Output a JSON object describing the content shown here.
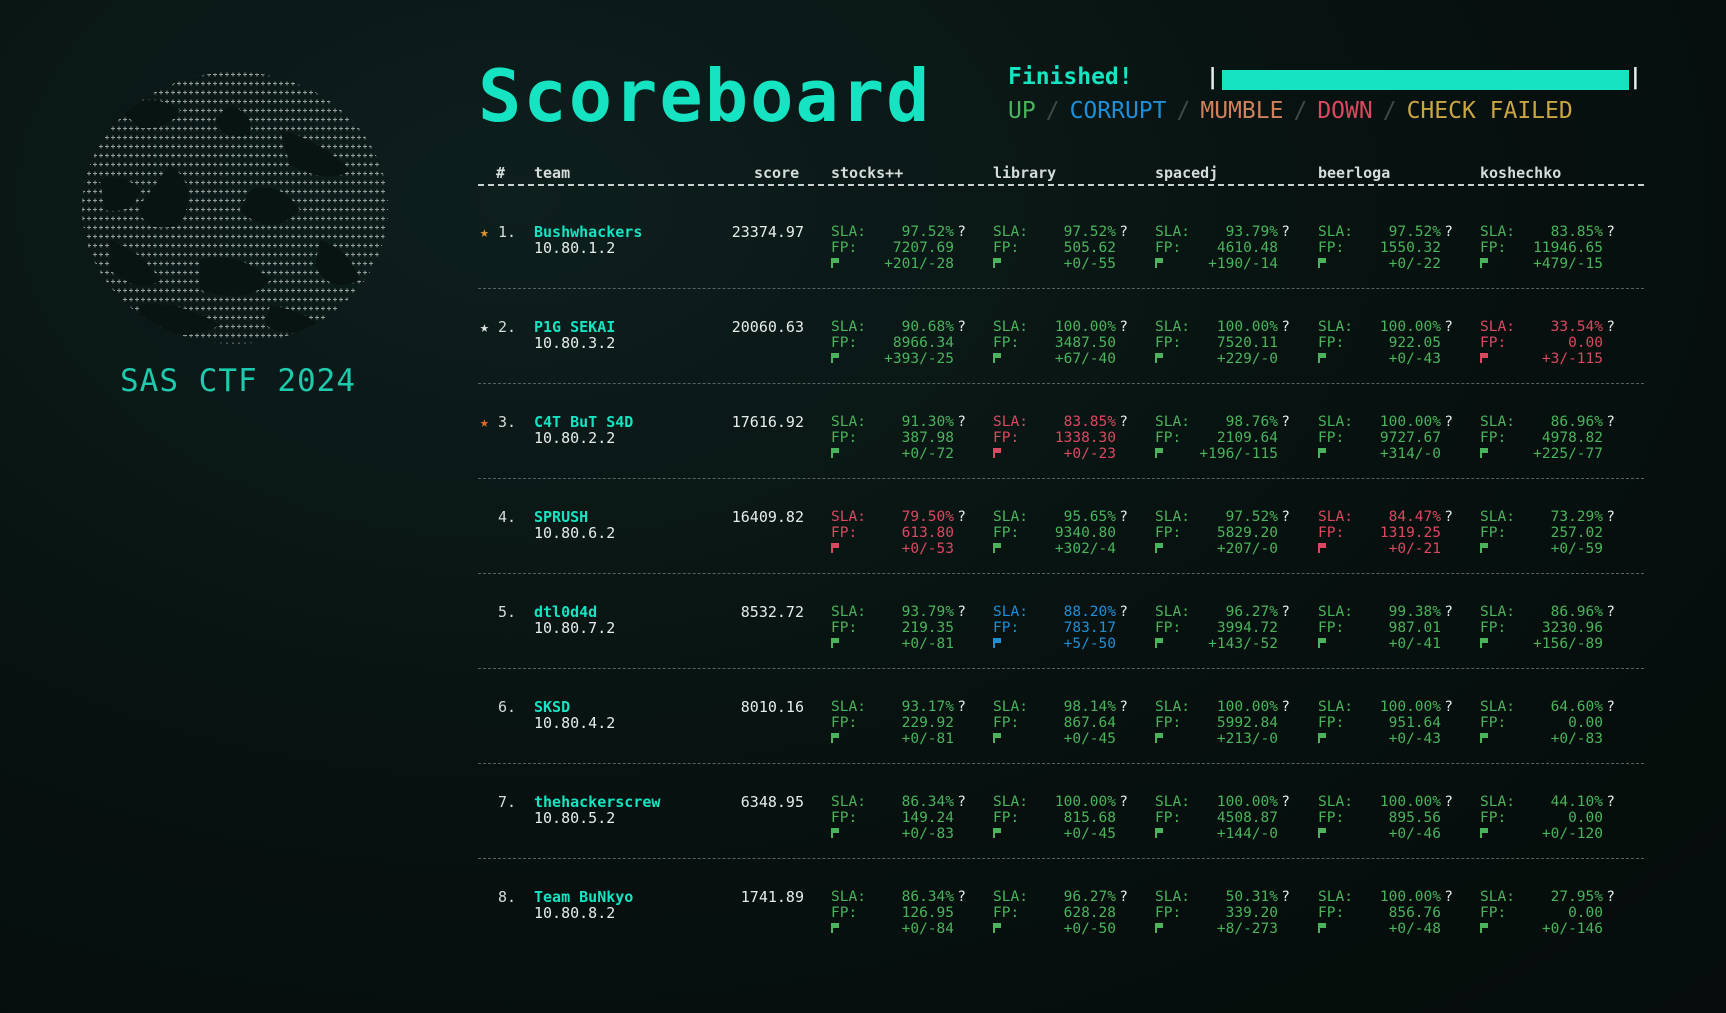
{
  "logo": {
    "icon": "ascii-globe-logo"
  },
  "event_title": "SAS CTF 2024",
  "page_title": "Scoreboard",
  "status": {
    "text": "Finished!",
    "progress": 1.0
  },
  "legend": [
    "UP",
    "CORRUPT",
    "MUMBLE",
    "DOWN",
    "CHECK FAILED"
  ],
  "colors": {
    "accent": "#15e3c1",
    "up": "#4ab35b",
    "corrupt": "#1e8fd6",
    "mumble": "#d0805b",
    "down": "#d9495f",
    "check_failed": "#c9a544"
  },
  "headers": {
    "rank": "#",
    "team": "team",
    "score": "score",
    "services": [
      "stocks++",
      "library",
      "spacedj",
      "beerloga",
      "koshechko"
    ]
  },
  "labels": {
    "sla": "SLA:",
    "fp": "FP:",
    "q": "?"
  },
  "teams": [
    {
      "rank": "1.",
      "star": "gold",
      "name": "Bushwhackers",
      "ip": "10.80.1.2",
      "score": "23374.97",
      "services": [
        {
          "state": "up",
          "sla": "97.52%",
          "fp": "7207.69",
          "flags": "+201/-28"
        },
        {
          "state": "up",
          "sla": "97.52%",
          "fp": "505.62",
          "flags": "+0/-55"
        },
        {
          "state": "up",
          "sla": "93.79%",
          "fp": "4610.48",
          "flags": "+190/-14"
        },
        {
          "state": "up",
          "sla": "97.52%",
          "fp": "1550.32",
          "flags": "+0/-22"
        },
        {
          "state": "up",
          "sla": "83.85%",
          "fp": "11946.65",
          "flags": "+479/-15"
        }
      ]
    },
    {
      "rank": "2.",
      "star": "silver",
      "name": "P1G SEKAI",
      "ip": "10.80.3.2",
      "score": "20060.63",
      "services": [
        {
          "state": "up",
          "sla": "90.68%",
          "fp": "8966.34",
          "flags": "+393/-25"
        },
        {
          "state": "up",
          "sla": "100.00%",
          "fp": "3487.50",
          "flags": "+67/-40"
        },
        {
          "state": "up",
          "sla": "100.00%",
          "fp": "7520.11",
          "flags": "+229/-0"
        },
        {
          "state": "up",
          "sla": "100.00%",
          "fp": "922.05",
          "flags": "+0/-43"
        },
        {
          "state": "down",
          "sla": "33.54%",
          "fp": "0.00",
          "flags": "+3/-115"
        }
      ]
    },
    {
      "rank": "3.",
      "star": "bronze",
      "name": "C4T BuT S4D",
      "ip": "10.80.2.2",
      "score": "17616.92",
      "services": [
        {
          "state": "up",
          "sla": "91.30%",
          "fp": "387.98",
          "flags": "+0/-72"
        },
        {
          "state": "down",
          "sla": "83.85%",
          "fp": "1338.30",
          "flags": "+0/-23"
        },
        {
          "state": "up",
          "sla": "98.76%",
          "fp": "2109.64",
          "flags": "+196/-115"
        },
        {
          "state": "up",
          "sla": "100.00%",
          "fp": "9727.67",
          "flags": "+314/-0"
        },
        {
          "state": "up",
          "sla": "86.96%",
          "fp": "4978.82",
          "flags": "+225/-77"
        }
      ]
    },
    {
      "rank": "4.",
      "star": "",
      "name": "SPRUSH",
      "ip": "10.80.6.2",
      "score": "16409.82",
      "services": [
        {
          "state": "down",
          "sla": "79.50%",
          "fp": "613.80",
          "flags": "+0/-53"
        },
        {
          "state": "up",
          "sla": "95.65%",
          "fp": "9340.80",
          "flags": "+302/-4"
        },
        {
          "state": "up",
          "sla": "97.52%",
          "fp": "5829.20",
          "flags": "+207/-0"
        },
        {
          "state": "down",
          "sla": "84.47%",
          "fp": "1319.25",
          "flags": "+0/-21"
        },
        {
          "state": "up",
          "sla": "73.29%",
          "fp": "257.02",
          "flags": "+0/-59"
        }
      ]
    },
    {
      "rank": "5.",
      "star": "",
      "name": "dtl0d4d",
      "ip": "10.80.7.2",
      "score": "8532.72",
      "services": [
        {
          "state": "up",
          "sla": "93.79%",
          "fp": "219.35",
          "flags": "+0/-81"
        },
        {
          "state": "corrupt",
          "sla": "88.20%",
          "fp": "783.17",
          "flags": "+5/-50"
        },
        {
          "state": "up",
          "sla": "96.27%",
          "fp": "3994.72",
          "flags": "+143/-52"
        },
        {
          "state": "up",
          "sla": "99.38%",
          "fp": "987.01",
          "flags": "+0/-41"
        },
        {
          "state": "up",
          "sla": "86.96%",
          "fp": "3230.96",
          "flags": "+156/-89"
        }
      ]
    },
    {
      "rank": "6.",
      "star": "",
      "name": "SKSD",
      "ip": "10.80.4.2",
      "score": "8010.16",
      "services": [
        {
          "state": "up",
          "sla": "93.17%",
          "fp": "229.92",
          "flags": "+0/-81"
        },
        {
          "state": "up",
          "sla": "98.14%",
          "fp": "867.64",
          "flags": "+0/-45"
        },
        {
          "state": "up",
          "sla": "100.00%",
          "fp": "5992.84",
          "flags": "+213/-0"
        },
        {
          "state": "up",
          "sla": "100.00%",
          "fp": "951.64",
          "flags": "+0/-43"
        },
        {
          "state": "up",
          "sla": "64.60%",
          "fp": "0.00",
          "flags": "+0/-83"
        }
      ]
    },
    {
      "rank": "7.",
      "star": "",
      "name": "thehackerscrew",
      "ip": "10.80.5.2",
      "score": "6348.95",
      "services": [
        {
          "state": "up",
          "sla": "86.34%",
          "fp": "149.24",
          "flags": "+0/-83"
        },
        {
          "state": "up",
          "sla": "100.00%",
          "fp": "815.68",
          "flags": "+0/-45"
        },
        {
          "state": "up",
          "sla": "100.00%",
          "fp": "4508.87",
          "flags": "+144/-0"
        },
        {
          "state": "up",
          "sla": "100.00%",
          "fp": "895.56",
          "flags": "+0/-46"
        },
        {
          "state": "up",
          "sla": "44.10%",
          "fp": "0.00",
          "flags": "+0/-120"
        }
      ]
    },
    {
      "rank": "8.",
      "star": "",
      "name": "Team BuNkyo",
      "ip": "10.80.8.2",
      "score": "1741.89",
      "services": [
        {
          "state": "up",
          "sla": "86.34%",
          "fp": "126.95",
          "flags": "+0/-84"
        },
        {
          "state": "up",
          "sla": "96.27%",
          "fp": "628.28",
          "flags": "+0/-50"
        },
        {
          "state": "up",
          "sla": "50.31%",
          "fp": "339.20",
          "flags": "+8/-273"
        },
        {
          "state": "up",
          "sla": "100.00%",
          "fp": "856.76",
          "flags": "+0/-48"
        },
        {
          "state": "up",
          "sla": "27.95%",
          "fp": "0.00",
          "flags": "+0/-146"
        }
      ]
    }
  ]
}
